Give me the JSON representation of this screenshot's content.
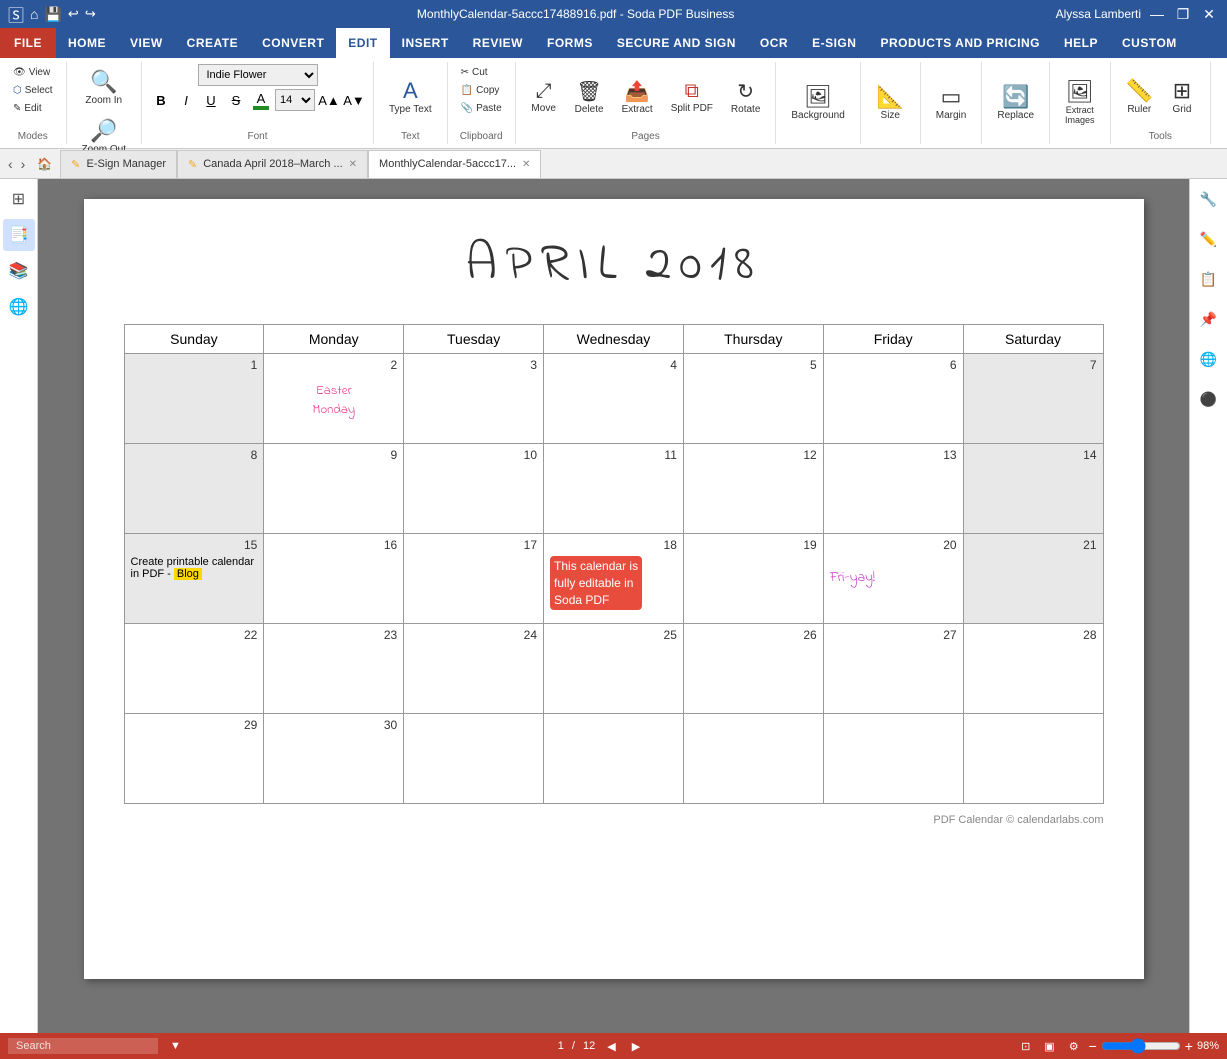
{
  "titleBar": {
    "filename": "MonthlyCalendar-5accc17488916.pdf",
    "appName": "Soda PDF Business",
    "title": "MonthlyCalendar-5accc17488916.pdf  -  Soda PDF Business",
    "userLabel": "Alyssa Lamberti",
    "controls": [
      "—",
      "❐",
      "✕"
    ]
  },
  "ribbon": {
    "tabs": [
      "FILE",
      "HOME",
      "VIEW",
      "CREATE",
      "CONVERT",
      "EDIT",
      "INSERT",
      "REVIEW",
      "FORMS",
      "SECURE AND SIGN",
      "OCR",
      "E-SIGN",
      "PRODUCTS AND PRICING",
      "HELP",
      "CUSTOM"
    ],
    "activeTab": "EDIT",
    "groups": {
      "modes": {
        "label": "Modes",
        "buttons": [
          "View",
          "Select",
          "Edit"
        ]
      },
      "zoom": {
        "label": "Zoom",
        "buttons": [
          "Zoom In",
          "Zoom Out"
        ]
      },
      "font": {
        "label": "Font",
        "currentFont": "Indie Flower",
        "fontSize": "14",
        "boldLabel": "B",
        "italicLabel": "I",
        "underlineLabel": "U",
        "strikeLabel": "S"
      },
      "text": {
        "label": "Text",
        "buttons": [
          "Type Text"
        ]
      },
      "clipboard": {
        "label": "Clipboard",
        "buttons": [
          "Cut",
          "Copy",
          "Paste"
        ]
      },
      "pages": {
        "label": "Pages",
        "buttons": [
          "Move",
          "Delete",
          "Extract",
          "Split PDF",
          "Rotate"
        ]
      },
      "background": {
        "label": "Background",
        "button": "Background"
      },
      "size": {
        "label": "Size",
        "button": "Size"
      },
      "margin": {
        "label": "Margin",
        "button": "Margin"
      },
      "replace": {
        "label": "Replace",
        "button": "Replace"
      },
      "extractImages": {
        "label": "Extract Images",
        "button": "Extract Images"
      },
      "tools": {
        "label": "Tools",
        "buttons": [
          "Ruler",
          "Grid"
        ]
      }
    }
  },
  "tabs": [
    {
      "id": "esign",
      "label": "E-Sign Manager",
      "active": false,
      "closeable": false,
      "hasEdit": false
    },
    {
      "id": "canada",
      "label": "Canada April 2018–March ...",
      "active": false,
      "closeable": true,
      "hasEdit": true
    },
    {
      "id": "monthly",
      "label": "MonthlyCalendar-5accc17...",
      "active": true,
      "closeable": true,
      "hasEdit": false
    }
  ],
  "sidebar": {
    "left": [
      "🏠",
      "📑",
      "🔖",
      "📚",
      "🌐"
    ],
    "right": [
      "🔧",
      "✏️",
      "📋",
      "📌",
      "🌍",
      "🔴"
    ]
  },
  "calendar": {
    "title": "APRIL  2018",
    "days": [
      "Sunday",
      "Monday",
      "Tuesday",
      "Wednesday",
      "Thursday",
      "Friday",
      "Saturday"
    ],
    "weeks": [
      [
        {
          "num": "1",
          "gray": true,
          "event": ""
        },
        {
          "num": "2",
          "gray": false,
          "event": "Easter Monday",
          "eventStyle": "easter"
        },
        {
          "num": "3",
          "gray": false,
          "event": ""
        },
        {
          "num": "4",
          "gray": false,
          "event": ""
        },
        {
          "num": "5",
          "gray": false,
          "event": ""
        },
        {
          "num": "6",
          "gray": false,
          "event": ""
        },
        {
          "num": "7",
          "gray": true,
          "event": ""
        }
      ],
      [
        {
          "num": "8",
          "gray": true,
          "event": ""
        },
        {
          "num": "9",
          "gray": false,
          "event": ""
        },
        {
          "num": "10",
          "gray": false,
          "event": ""
        },
        {
          "num": "11",
          "gray": false,
          "event": ""
        },
        {
          "num": "12",
          "gray": false,
          "event": ""
        },
        {
          "num": "13",
          "gray": false,
          "event": ""
        },
        {
          "num": "14",
          "gray": true,
          "event": ""
        }
      ],
      [
        {
          "num": "15",
          "gray": true,
          "event": ""
        },
        {
          "num": "16",
          "gray": false,
          "event": ""
        },
        {
          "num": "17",
          "gray": false,
          "event": ""
        },
        {
          "num": "18",
          "gray": false,
          "event": "red-highlight"
        },
        {
          "num": "19",
          "gray": false,
          "event": ""
        },
        {
          "num": "20",
          "gray": false,
          "event": "fri-yay"
        },
        {
          "num": "21",
          "gray": true,
          "event": ""
        }
      ],
      [
        {
          "num": "22",
          "gray": false,
          "event": ""
        },
        {
          "num": "23",
          "gray": false,
          "event": ""
        },
        {
          "num": "24",
          "gray": false,
          "event": ""
        },
        {
          "num": "25",
          "gray": false,
          "event": ""
        },
        {
          "num": "26",
          "gray": false,
          "event": ""
        },
        {
          "num": "27",
          "gray": false,
          "event": ""
        },
        {
          "num": "28",
          "gray": false,
          "event": ""
        }
      ],
      [
        {
          "num": "29",
          "gray": false,
          "event": ""
        },
        {
          "num": "30",
          "gray": false,
          "event": ""
        },
        {
          "num": "",
          "gray": false,
          "event": ""
        },
        {
          "num": "",
          "gray": false,
          "event": ""
        },
        {
          "num": "",
          "gray": false,
          "event": ""
        },
        {
          "num": "",
          "gray": false,
          "event": ""
        },
        {
          "num": "",
          "gray": false,
          "event": ""
        }
      ]
    ],
    "cell15Event": "Create printable calendar in PDF - Blog",
    "cell18Event": "This calendar is fully editable in Soda PDF",
    "cell20Event": "Fri-yay!",
    "easterEvent": "Easter\nMonday",
    "copyright": "PDF Calendar © calendarlabs.com"
  },
  "statusBar": {
    "searchPlaceholder": "Search",
    "pageIndicator": "1",
    "totalPages": "12",
    "zoomLevel": "98%"
  }
}
